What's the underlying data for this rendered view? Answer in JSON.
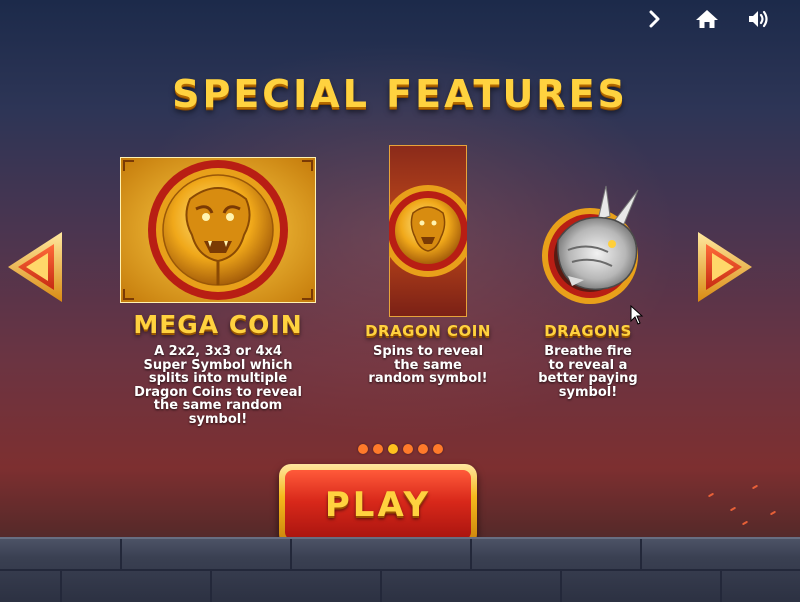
{
  "header": {
    "icons": [
      "chevron-right-icon",
      "home-icon",
      "speaker-icon"
    ]
  },
  "title": "SPECIAL FEATURES",
  "features": [
    {
      "name": "MEGA COIN",
      "description_lines": [
        "A 2x2, 3x3 or 4x4",
        "Super Symbol which",
        "splits into multiple",
        "Dragon Coins to reveal",
        "the same random",
        "symbol!"
      ]
    },
    {
      "name": "DRAGON COIN",
      "description_lines": [
        "Spins to reveal",
        "the same",
        "random symbol!"
      ]
    },
    {
      "name": "DRAGONS",
      "description_lines": [
        "Breathe fire",
        "to reveal a",
        "better paying",
        "symbol!"
      ]
    }
  ],
  "pagination": {
    "count": 6,
    "active_index": 2
  },
  "play_label": "PLAY",
  "colors": {
    "title_gold": "#ffd23f",
    "play_red": "#d8281a",
    "dot_orange": "#ff7a2a",
    "dot_active": "#ffc21e"
  }
}
